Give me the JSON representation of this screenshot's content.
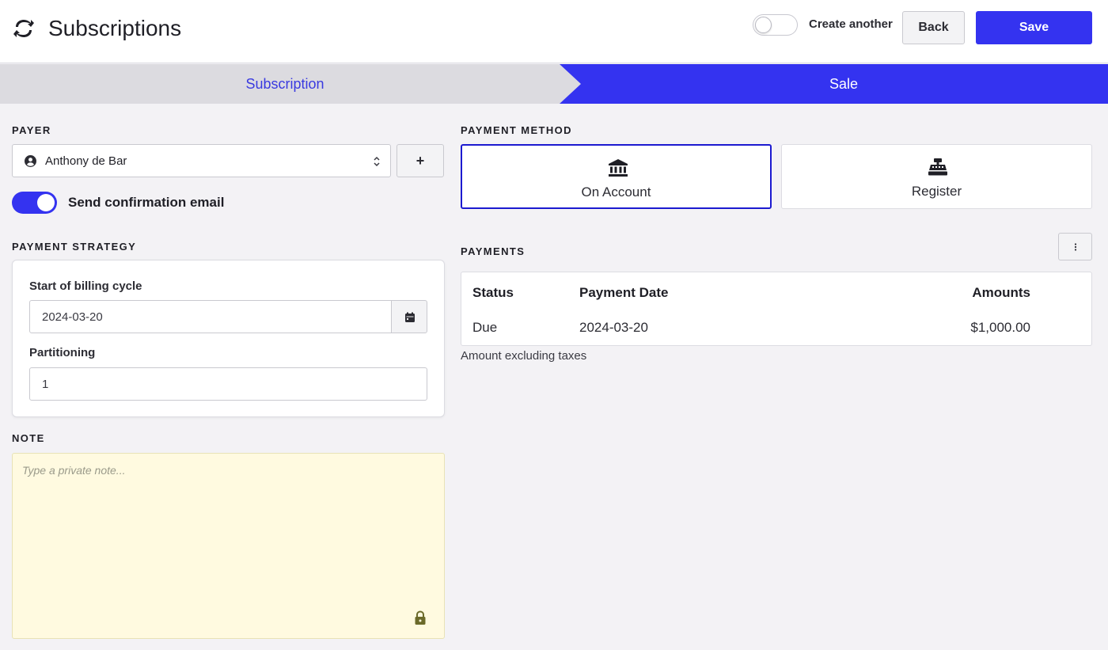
{
  "header": {
    "title": "Subscriptions",
    "app_icon": "refresh-icon",
    "create_another_label": "Create another",
    "create_another_enabled": false,
    "back_label": "Back",
    "save_label": "Save",
    "accent_color": "#3433f0"
  },
  "stepper": {
    "steps": [
      {
        "label": "Subscription",
        "active": false
      },
      {
        "label": "Sale",
        "active": true
      }
    ]
  },
  "payer": {
    "section_label": "PAYER",
    "selected": "Anthony de Bar",
    "add_label": "+",
    "send_email_label": "Send confirmation email",
    "send_email_enabled": true
  },
  "strategy": {
    "section_label": "PAYMENT STRATEGY",
    "billing_start_label": "Start of billing cycle",
    "billing_start_value": "2024-03-20",
    "partitioning_label": "Partitioning",
    "partitioning_value": "1"
  },
  "note": {
    "section_label": "NOTE",
    "placeholder": "Type a private note...",
    "background_color": "#fffae0"
  },
  "payment_method": {
    "section_label": "PAYMENT METHOD",
    "options": [
      {
        "label": "On Account",
        "icon": "bank-icon",
        "selected": true
      },
      {
        "label": "Register",
        "icon": "cash-register-icon",
        "selected": false
      }
    ]
  },
  "payments": {
    "section_label": "PAYMENTS",
    "columns": [
      "Status",
      "Payment Date",
      "Amounts"
    ],
    "rows": [
      {
        "status": "Due",
        "date": "2024-03-20",
        "amount": "$1,000.00"
      }
    ],
    "footnote": "Amount excluding taxes"
  }
}
